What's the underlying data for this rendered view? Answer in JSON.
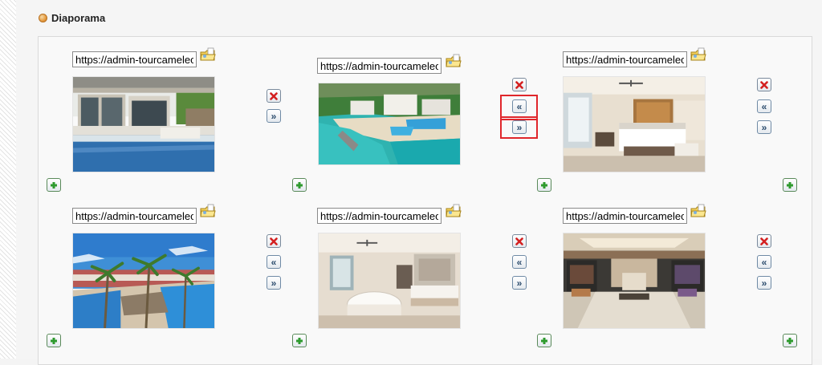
{
  "section": {
    "title": "Diaporama"
  },
  "slides": [
    {
      "url": "https://admin-tourcameleon"
    },
    {
      "url": "https://admin-tourcameleon"
    },
    {
      "url": "https://admin-tourcameleon"
    },
    {
      "url": "https://admin-tourcameleon"
    },
    {
      "url": "https://admin-tourcameleon"
    },
    {
      "url": "https://admin-tourcameleon"
    }
  ],
  "icons": {
    "browse": "folder-browse-icon",
    "delete": "delete-icon",
    "move_left": "move-left-icon",
    "move_right": "move-right-icon",
    "add": "add-icon"
  },
  "colors": {
    "delete": "#d42020",
    "add": "#2f9b2f",
    "highlight": "#e0262b"
  }
}
